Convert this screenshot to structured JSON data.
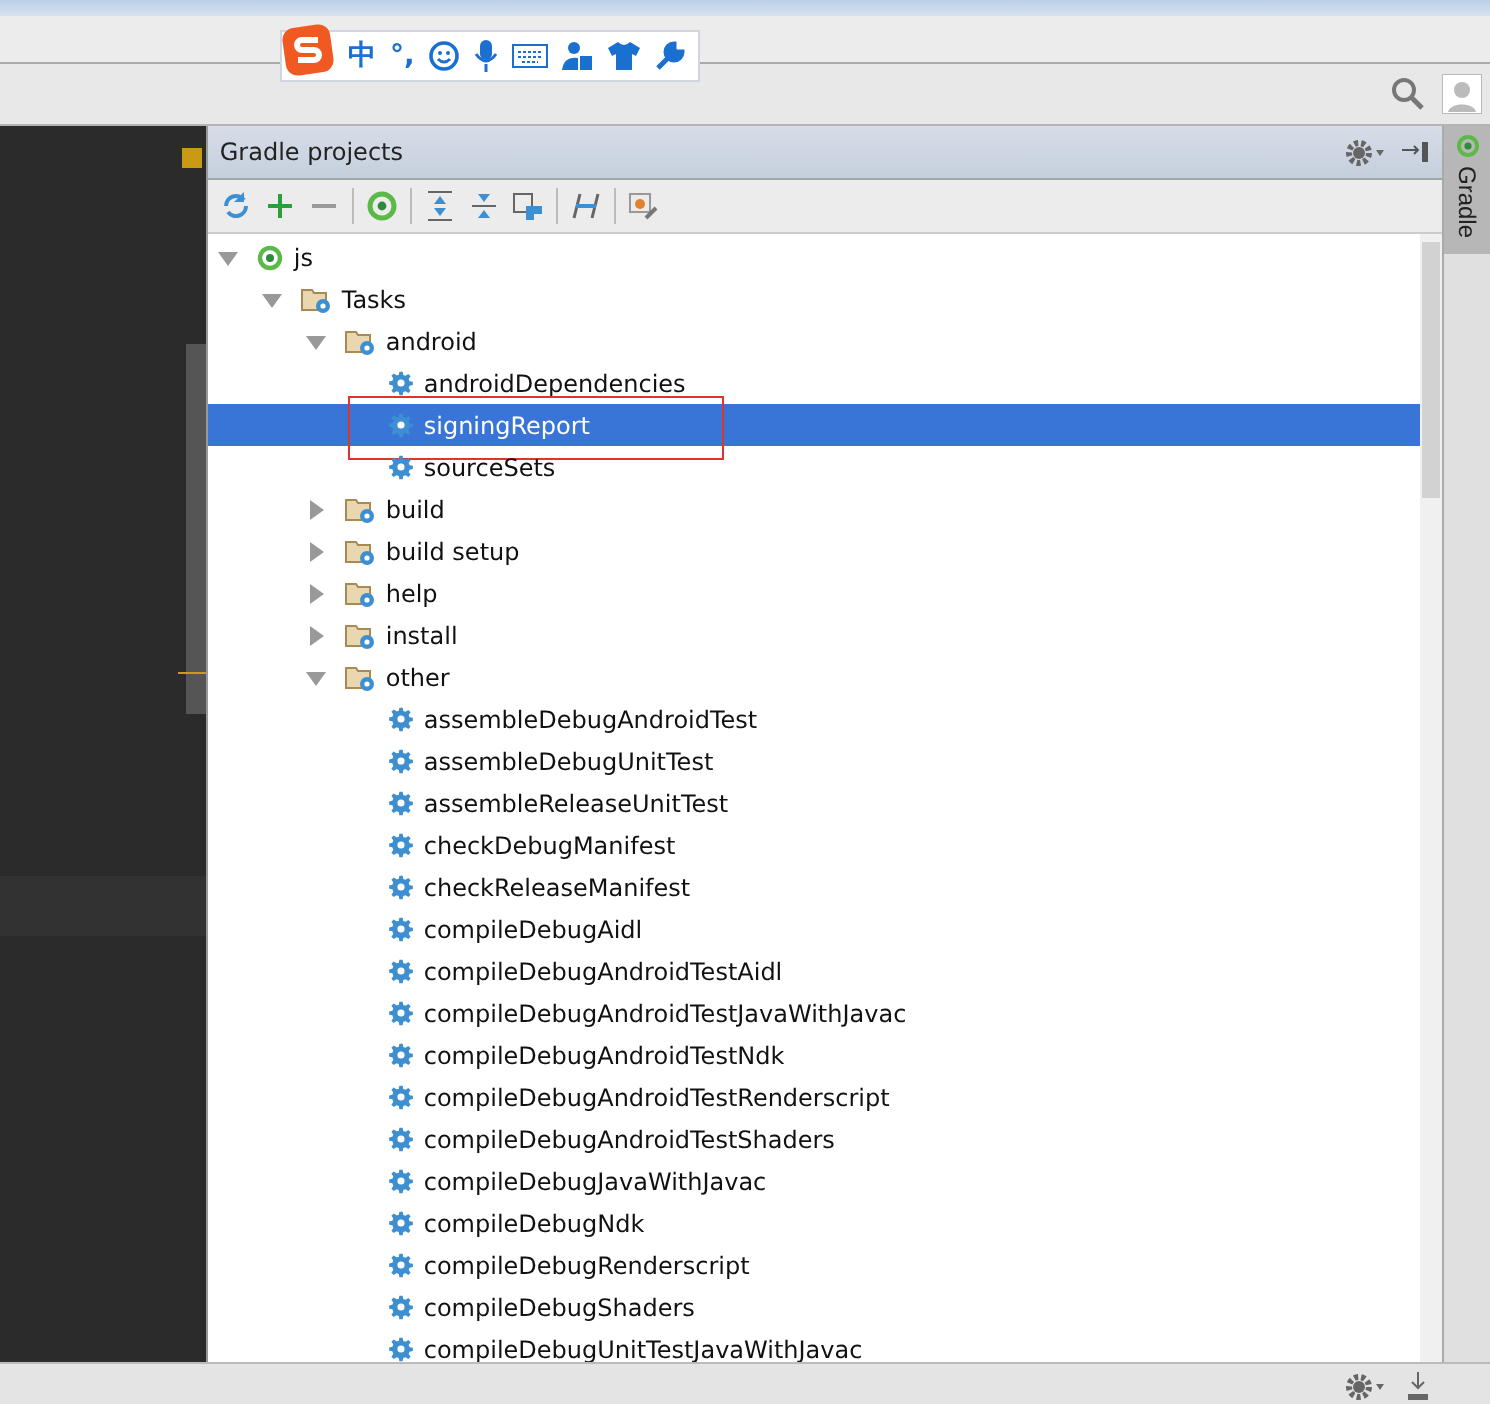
{
  "ime_bar": {
    "items": [
      "中",
      "°,"
    ]
  },
  "panel": {
    "title": "Gradle projects"
  },
  "side_tab": {
    "label": "Gradle"
  },
  "tree": [
    {
      "label": "js",
      "kind": "project",
      "expanded": true,
      "selected": false,
      "children": [
        {
          "label": "Tasks",
          "kind": "folder",
          "expanded": true,
          "selected": false,
          "children": [
            {
              "label": "android",
              "kind": "folder",
              "expanded": true,
              "selected": false,
              "children": [
                {
                  "label": "androidDependencies",
                  "kind": "task",
                  "selected": false
                },
                {
                  "label": "signingReport",
                  "kind": "task",
                  "selected": true
                },
                {
                  "label": "sourceSets",
                  "kind": "task",
                  "selected": false
                }
              ]
            },
            {
              "label": "build",
              "kind": "folder",
              "expanded": false,
              "selected": false
            },
            {
              "label": "build setup",
              "kind": "folder",
              "expanded": false,
              "selected": false
            },
            {
              "label": "help",
              "kind": "folder",
              "expanded": false,
              "selected": false
            },
            {
              "label": "install",
              "kind": "folder",
              "expanded": false,
              "selected": false
            },
            {
              "label": "other",
              "kind": "folder",
              "expanded": true,
              "selected": false,
              "children": [
                {
                  "label": "assembleDebugAndroidTest",
                  "kind": "task",
                  "selected": false
                },
                {
                  "label": "assembleDebugUnitTest",
                  "kind": "task",
                  "selected": false
                },
                {
                  "label": "assembleReleaseUnitTest",
                  "kind": "task",
                  "selected": false
                },
                {
                  "label": "checkDebugManifest",
                  "kind": "task",
                  "selected": false
                },
                {
                  "label": "checkReleaseManifest",
                  "kind": "task",
                  "selected": false
                },
                {
                  "label": "compileDebugAidl",
                  "kind": "task",
                  "selected": false
                },
                {
                  "label": "compileDebugAndroidTestAidl",
                  "kind": "task",
                  "selected": false
                },
                {
                  "label": "compileDebugAndroidTestJavaWithJavac",
                  "kind": "task",
                  "selected": false
                },
                {
                  "label": "compileDebugAndroidTestNdk",
                  "kind": "task",
                  "selected": false
                },
                {
                  "label": "compileDebugAndroidTestRenderscript",
                  "kind": "task",
                  "selected": false
                },
                {
                  "label": "compileDebugAndroidTestShaders",
                  "kind": "task",
                  "selected": false
                },
                {
                  "label": "compileDebugJavaWithJavac",
                  "kind": "task",
                  "selected": false
                },
                {
                  "label": "compileDebugNdk",
                  "kind": "task",
                  "selected": false
                },
                {
                  "label": "compileDebugRenderscript",
                  "kind": "task",
                  "selected": false
                },
                {
                  "label": "compileDebugShaders",
                  "kind": "task",
                  "selected": false
                },
                {
                  "label": "compileDebugUnitTestJavaWithJavac",
                  "kind": "task",
                  "selected": false
                }
              ]
            }
          ]
        }
      ]
    }
  ]
}
